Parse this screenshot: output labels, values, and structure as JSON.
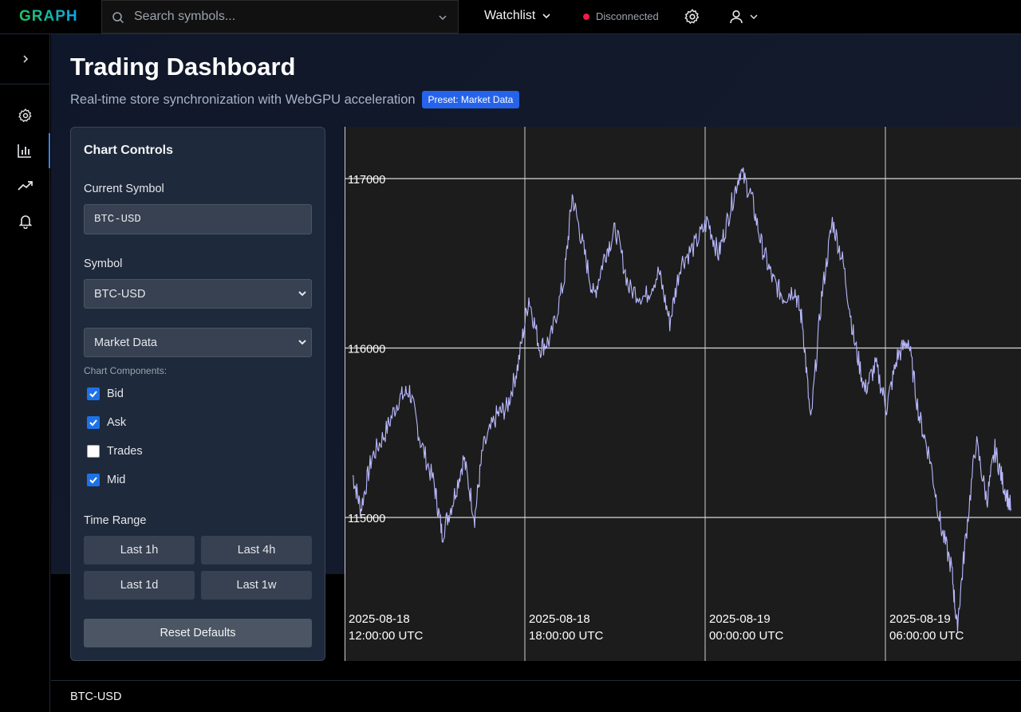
{
  "app": {
    "logo": "GRAPH"
  },
  "search": {
    "placeholder": "Search symbols..."
  },
  "header": {
    "watchlist_label": "Watchlist",
    "connection_status": "Disconnected",
    "status_color": "#ef1c45"
  },
  "page": {
    "title": "Trading Dashboard",
    "subtitle": "Real-time store synchronization with WebGPU acceleration",
    "preset_badge": "Preset: Market Data"
  },
  "controls": {
    "title": "Chart Controls",
    "current_symbol_label": "Current Symbol",
    "current_symbol_value": "BTC-USD",
    "symbol_label": "Symbol",
    "symbol_selected": "BTC-USD",
    "preset_selected": "Market Data",
    "components_label": "Chart Components:",
    "components": [
      {
        "label": "Bid",
        "checked": true
      },
      {
        "label": "Ask",
        "checked": true
      },
      {
        "label": "Trades",
        "checked": false
      },
      {
        "label": "Mid",
        "checked": true
      }
    ],
    "time_range_label": "Time Range",
    "time_ranges": [
      "Last 1h",
      "Last 4h",
      "Last 1d",
      "Last 1w"
    ],
    "reset_label": "Reset Defaults"
  },
  "footer": {
    "symbol": "BTC-USD"
  },
  "chart_data": {
    "type": "line",
    "series_color": "#b8b8ff",
    "y_ticks": [
      "117000",
      "116000",
      "115000"
    ],
    "x_ticks": [
      {
        "date": "2025-08-18",
        "time": "12:00:00 UTC"
      },
      {
        "date": "2025-08-18",
        "time": "18:00:00 UTC"
      },
      {
        "date": "2025-08-19",
        "time": "00:00:00 UTC"
      },
      {
        "date": "2025-08-19",
        "time": "06:00:00 UTC"
      }
    ],
    "ylim": [
      114300,
      117300
    ],
    "xlim": [
      "2025-08-18T12:00:00Z",
      "2025-08-19T08:48:00Z"
    ],
    "grid": true,
    "points": [
      [
        "2025-08-18T12:15:00Z",
        115250
      ],
      [
        "2025-08-18T12:30:00Z",
        115050
      ],
      [
        "2025-08-18T12:50:00Z",
        115350
      ],
      [
        "2025-08-18T13:15:00Z",
        115500
      ],
      [
        "2025-08-18T13:40:00Z",
        115700
      ],
      [
        "2025-08-18T14:00:00Z",
        115750
      ],
      [
        "2025-08-18T14:20:00Z",
        115450
      ],
      [
        "2025-08-18T14:45:00Z",
        115200
      ],
      [
        "2025-08-18T15:00:00Z",
        114900
      ],
      [
        "2025-08-18T15:20:00Z",
        115100
      ],
      [
        "2025-08-18T15:40:00Z",
        115350
      ],
      [
        "2025-08-18T16:00:00Z",
        115000
      ],
      [
        "2025-08-18T16:15:00Z",
        115400
      ],
      [
        "2025-08-18T16:40:00Z",
        115600
      ],
      [
        "2025-08-18T17:00:00Z",
        115650
      ],
      [
        "2025-08-18T17:20:00Z",
        115900
      ],
      [
        "2025-08-18T17:40:00Z",
        116300
      ],
      [
        "2025-08-18T18:00:00Z",
        116000
      ],
      [
        "2025-08-18T18:20:00Z",
        116050
      ],
      [
        "2025-08-18T18:45:00Z",
        116400
      ],
      [
        "2025-08-18T19:00:00Z",
        116900
      ],
      [
        "2025-08-18T19:20:00Z",
        116600
      ],
      [
        "2025-08-18T19:40:00Z",
        116300
      ],
      [
        "2025-08-18T20:00:00Z",
        116550
      ],
      [
        "2025-08-18T20:20:00Z",
        116700
      ],
      [
        "2025-08-18T20:45:00Z",
        116350
      ],
      [
        "2025-08-18T21:15:00Z",
        116300
      ],
      [
        "2025-08-18T21:40:00Z",
        116450
      ],
      [
        "2025-08-18T22:00:00Z",
        116150
      ],
      [
        "2025-08-18T22:20:00Z",
        116500
      ],
      [
        "2025-08-18T22:45:00Z",
        116600
      ],
      [
        "2025-08-18T23:10:00Z",
        116750
      ],
      [
        "2025-08-18T23:30:00Z",
        116550
      ],
      [
        "2025-08-18T23:50:00Z",
        116800
      ],
      [
        "2025-08-19T00:10:00Z",
        117050
      ],
      [
        "2025-08-19T00:30:00Z",
        116900
      ],
      [
        "2025-08-19T00:50:00Z",
        116600
      ],
      [
        "2025-08-19T01:10:00Z",
        116400
      ],
      [
        "2025-08-19T01:30:00Z",
        116300
      ],
      [
        "2025-08-19T01:50:00Z",
        116350
      ],
      [
        "2025-08-19T02:05:00Z",
        116150
      ],
      [
        "2025-08-19T02:20:00Z",
        115550
      ],
      [
        "2025-08-19T02:40:00Z",
        116300
      ],
      [
        "2025-08-19T03:00:00Z",
        116750
      ],
      [
        "2025-08-19T03:20:00Z",
        116500
      ],
      [
        "2025-08-19T03:40:00Z",
        116050
      ],
      [
        "2025-08-19T04:00:00Z",
        115750
      ],
      [
        "2025-08-19T04:20:00Z",
        115900
      ],
      [
        "2025-08-19T04:40:00Z",
        115650
      ],
      [
        "2025-08-19T05:00:00Z",
        115950
      ],
      [
        "2025-08-19T05:20:00Z",
        116050
      ],
      [
        "2025-08-19T05:40:00Z",
        115600
      ],
      [
        "2025-08-19T06:00:00Z",
        115350
      ],
      [
        "2025-08-19T06:20:00Z",
        114950
      ],
      [
        "2025-08-19T06:40:00Z",
        114700
      ],
      [
        "2025-08-19T06:50:00Z",
        114350
      ],
      [
        "2025-08-19T07:05:00Z",
        114850
      ],
      [
        "2025-08-19T07:25:00Z",
        115450
      ],
      [
        "2025-08-19T07:45:00Z",
        115100
      ],
      [
        "2025-08-19T08:00:00Z",
        115400
      ],
      [
        "2025-08-19T08:15:00Z",
        115200
      ],
      [
        "2025-08-19T08:30:00Z",
        115050
      ]
    ]
  }
}
